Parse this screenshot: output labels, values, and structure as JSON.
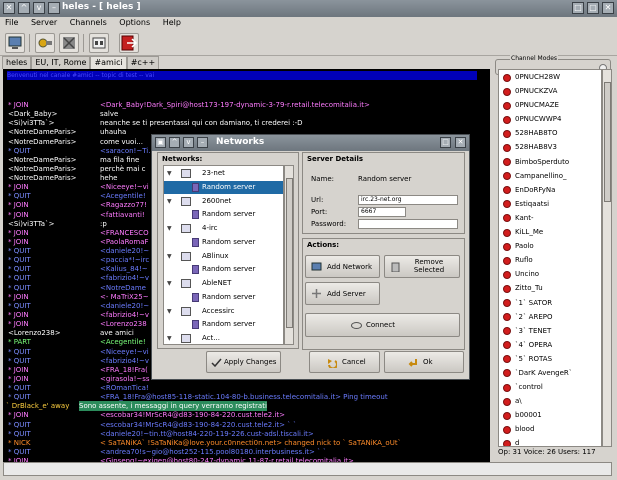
{
  "window": {
    "title": "heles - [ heles ]"
  },
  "menu": [
    "File",
    "Server",
    "Channels",
    "Options",
    "Help"
  ],
  "tabs": [
    "heles",
    "EU, IT, Rome",
    "#amici",
    "#c++"
  ],
  "topic": "Benvenuti nel canale #amici  --  topic di test  --  vai",
  "chat": [
    {
      "nick": "* JOIN",
      "msg": "<Dark_Baby!Dark_Spiri@host173-197-dynamic-3-79-r.retail.telecomitalia.it>",
      "nc": "c-join",
      "mc": "c-joinmsg"
    },
    {
      "nick": "<Dark_Baby>",
      "msg": "salve",
      "nc": "c-white",
      "mc": "c-msg"
    },
    {
      "nick": "<Si)vi3TTa`>",
      "msg": "neanche se ti presentassi qui con damiano, ti crederei :-D",
      "nc": "c-white",
      "mc": "c-msg"
    },
    {
      "nick": "<NotreDameParis>",
      "msg": "uhauha",
      "nc": "c-white",
      "mc": "c-msg"
    },
    {
      "nick": "<NotreDameParis>",
      "msg": "come vuoi...",
      "nc": "c-white",
      "mc": "c-msg"
    },
    {
      "nick": "* QUIT",
      "msg": "<saracon!~Ti...",
      "nc": "c-quit",
      "mc": "c-quitmsg"
    },
    {
      "nick": "<NotreDameParis>",
      "msg": "ma fila fine",
      "nc": "c-white",
      "mc": "c-msg"
    },
    {
      "nick": "<NotreDameParis>",
      "msg": "perchè mai c",
      "nc": "c-white",
      "mc": "c-msg"
    },
    {
      "nick": "<NotreDameParis>",
      "msg": "hehe",
      "nc": "c-white",
      "mc": "c-msg"
    },
    {
      "nick": "* JOIN",
      "msg": "<Niceeye!~vi",
      "nc": "c-join",
      "mc": "c-joinmsg"
    },
    {
      "nick": "* QUIT",
      "msg": "<Acegentile!",
      "nc": "c-quit",
      "mc": "c-quitmsg"
    },
    {
      "nick": "* JOIN",
      "msg": "<Ragazzo77!",
      "nc": "c-join",
      "mc": "c-joinmsg"
    },
    {
      "nick": "* JOIN",
      "msg": "<fattiavanti!",
      "nc": "c-join",
      "mc": "c-joinmsg"
    },
    {
      "nick": "<Si)vi3TTa`>",
      "msg": ":p",
      "nc": "c-white",
      "mc": "c-msg"
    },
    {
      "nick": "* JOIN",
      "msg": "<FRANCESCO",
      "nc": "c-join",
      "mc": "c-joinmsg"
    },
    {
      "nick": "* JOIN",
      "msg": "<PaolaRomaF",
      "nc": "c-join",
      "mc": "c-joinmsg"
    },
    {
      "nick": "* QUIT",
      "msg": "<daniele20!~",
      "nc": "c-quit",
      "mc": "c-quitmsg"
    },
    {
      "nick": "* QUIT",
      "msg": "<paccia*!~irc",
      "nc": "c-quit",
      "mc": "c-quitmsg"
    },
    {
      "nick": "* QUIT",
      "msg": "<Kalius_84!~",
      "nc": "c-quit",
      "mc": "c-quitmsg"
    },
    {
      "nick": "* QUIT",
      "msg": "<fabrizio4!~v",
      "nc": "c-quit",
      "mc": "c-quitmsg"
    },
    {
      "nick": "* QUIT",
      "msg": "<NotreDame",
      "nc": "c-quit",
      "mc": "c-quitmsg"
    },
    {
      "nick": "* JOIN",
      "msg": "<- MaTriX25~",
      "nc": "c-join",
      "mc": "c-joinmsg"
    },
    {
      "nick": "* QUIT",
      "msg": "<daniele20!~",
      "nc": "c-quit",
      "mc": "c-quitmsg"
    },
    {
      "nick": "* JOIN",
      "msg": "<fabrizio4!~v",
      "nc": "c-join",
      "mc": "c-joinmsg"
    },
    {
      "nick": "* JOIN",
      "msg": "<Lorenzo238",
      "nc": "c-join",
      "mc": "c-joinmsg"
    },
    {
      "nick": "<Lorenzo238>",
      "msg": "ave amici",
      "nc": "c-white",
      "mc": "c-msg"
    },
    {
      "nick": "* PART",
      "msg": "<Acegentile!",
      "nc": "c-part",
      "mc": "c-part"
    },
    {
      "nick": "* QUIT",
      "msg": "<Niceeye!~vi",
      "nc": "c-quit",
      "mc": "c-quitmsg"
    },
    {
      "nick": "* QUIT",
      "msg": "<fabrizio4!~v",
      "nc": "c-quit",
      "mc": "c-quitmsg"
    },
    {
      "nick": "* JOIN",
      "msg": "<FRA_18!Fra(",
      "nc": "c-join",
      "mc": "c-joinmsg"
    },
    {
      "nick": "* JOIN",
      "msg": "<girasola!~ss",
      "nc": "c-join",
      "mc": "c-joinmsg"
    },
    {
      "nick": "* QUIT",
      "msg": "<ROmanTica!",
      "nc": "c-quit",
      "mc": "c-quitmsg"
    },
    {
      "nick": "* QUIT",
      "msg": "<FRA_18!Fra@host85-118-static.104-80-b.business.telecomitalia.it>  Ping timeout",
      "nc": "c-quit",
      "mc": "c-quitmsg"
    },
    {
      "nick": "",
      "msg": "",
      "nc": "c-white",
      "mc": "c-msg",
      "away": true
    },
    {
      "nick": "* JOIN",
      "msg": "<escobar34!MrScR4@d83-190-84-220.cust.tele2.it>",
      "nc": "c-join",
      "mc": "c-joinmsg"
    },
    {
      "nick": "* QUIT",
      "msg": "<escobar34!MrScR4@d83-190-84-220.cust.tele2.it>  ` `",
      "nc": "c-quit",
      "mc": "c-quitmsg"
    },
    {
      "nick": "* QUIT",
      "msg": "<daniele20!~tin.tt@host84-220-119-226.cust-adsl.tiscali.it>",
      "nc": "c-quit",
      "mc": "c-quitmsg"
    },
    {
      "nick": "* NICK",
      "msg": "< SaTANiKA` !SaTaNiKa@love.your.c0nnecti0n.net>  changed nick to  ` SaTANiKA_oUt`",
      "nc": "c-nick",
      "mc": "c-nick"
    },
    {
      "nick": "* QUIT",
      "msg": "<andrea70!s~gio@host252-115.pool80180.interbusiness.it>  ` `",
      "nc": "c-quit",
      "mc": "c-quitmsg"
    },
    {
      "nick": "* JOIN",
      "msg": "<Ginseng!~exigen@host80-247-dynamic.11-87-r.retail.telecomitalia.it>",
      "nc": "c-join",
      "mc": "c-joinmsg"
    }
  ],
  "away_line": {
    "text": "` DrBlack_e' away",
    "highlight": "Sono assente, i messaggi in query verranno registrati"
  },
  "userlist": {
    "frame_label": "Channel Modes",
    "users": [
      "0PNUCH28W",
      "0PNUCKZVA",
      "0PNUCMAZE",
      "0PNUCWWP4",
      "528HAB8TO",
      "528HAB8V3",
      "BimboSperduto",
      "Campanellino_",
      "EnDoRFyNa",
      "Estiqaatsi",
      "Kant-",
      "KiLL_Me",
      "Paolo",
      "Ruflo",
      "Uncino",
      "Zitto_Tu",
      "`1` SATOR",
      "`2` AREPO",
      "`3` TENET",
      "`4` OPERA",
      "`5` ROTAS",
      "`DarK AvengeR`",
      "`control",
      "a\\",
      "b00001",
      "blood",
      "d"
    ],
    "status": "Op: 31 Voice: 26 Users: 117"
  },
  "dialog": {
    "title": "Networks",
    "networks_label": "Networks:",
    "tree": [
      {
        "type": "net",
        "label": "23-net"
      },
      {
        "type": "server",
        "label": "Random server",
        "selected": true
      },
      {
        "type": "net",
        "label": "2600net"
      },
      {
        "type": "server",
        "label": "Random server"
      },
      {
        "type": "net",
        "label": "4-irc"
      },
      {
        "type": "server",
        "label": "Random server"
      },
      {
        "type": "net",
        "label": "ABlinux"
      },
      {
        "type": "server",
        "label": "Random server"
      },
      {
        "type": "net",
        "label": "AbleNET"
      },
      {
        "type": "server",
        "label": "Random server"
      },
      {
        "type": "net",
        "label": "Accessirc"
      },
      {
        "type": "server",
        "label": "Random server"
      },
      {
        "type": "net",
        "label": "Act..."
      }
    ],
    "details": {
      "header": "Server Details",
      "name_label": "Name:",
      "name_value": "Random server",
      "url_label": "Url:",
      "url_value": "irc.23-net.org",
      "port_label": "Port:",
      "port_value": "6667",
      "password_label": "Password:",
      "password_value": ""
    },
    "actions": {
      "header": "Actions:",
      "add_network": "Add Network",
      "remove_selected": "Remove Selected",
      "add_server": "Add Server",
      "connect": "Connect"
    },
    "buttons": {
      "apply": "Apply Changes",
      "cancel": "Cancel",
      "ok": "Ok"
    }
  }
}
